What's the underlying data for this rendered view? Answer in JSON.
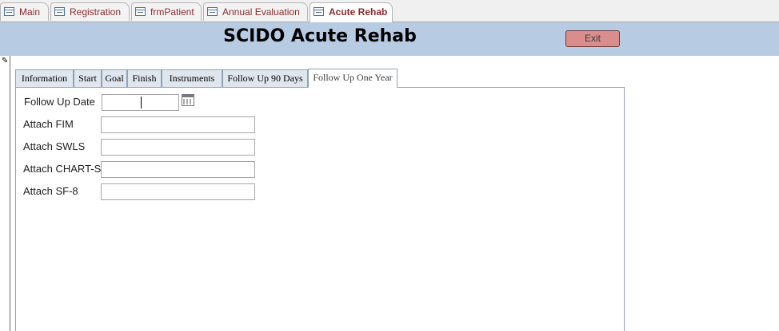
{
  "doc_tabs": [
    {
      "label": "Main"
    },
    {
      "label": "Registration"
    },
    {
      "label": "frmPatient"
    },
    {
      "label": "Annual Evaluation"
    },
    {
      "label": "Acute Rehab",
      "active": true
    }
  ],
  "header": {
    "title": "SCIDO Acute Rehab",
    "exit_label": "Exit"
  },
  "tabs": [
    {
      "label": "Information"
    },
    {
      "label": "Start"
    },
    {
      "label": "Goal"
    },
    {
      "label": "Finish"
    },
    {
      "label": "Instruments"
    },
    {
      "label": "Follow Up 90 Days"
    },
    {
      "label": "Follow Up One Year",
      "active": true
    }
  ],
  "fields": {
    "follow_up_date": {
      "label": "Follow Up Date",
      "value": ""
    },
    "attach_fim": {
      "label": "Attach FIM",
      "value": ""
    },
    "attach_swls": {
      "label": "Attach SWLS",
      "value": ""
    },
    "attach_chart_s": {
      "label": "Attach CHART-S",
      "value": ""
    },
    "attach_sf8": {
      "label": "Attach SF-8",
      "value": ""
    }
  },
  "colors": {
    "header_bg": "#b7cbe2",
    "exit_button": "#d98d8d",
    "doc_tab_text": "#8b2b2b"
  }
}
